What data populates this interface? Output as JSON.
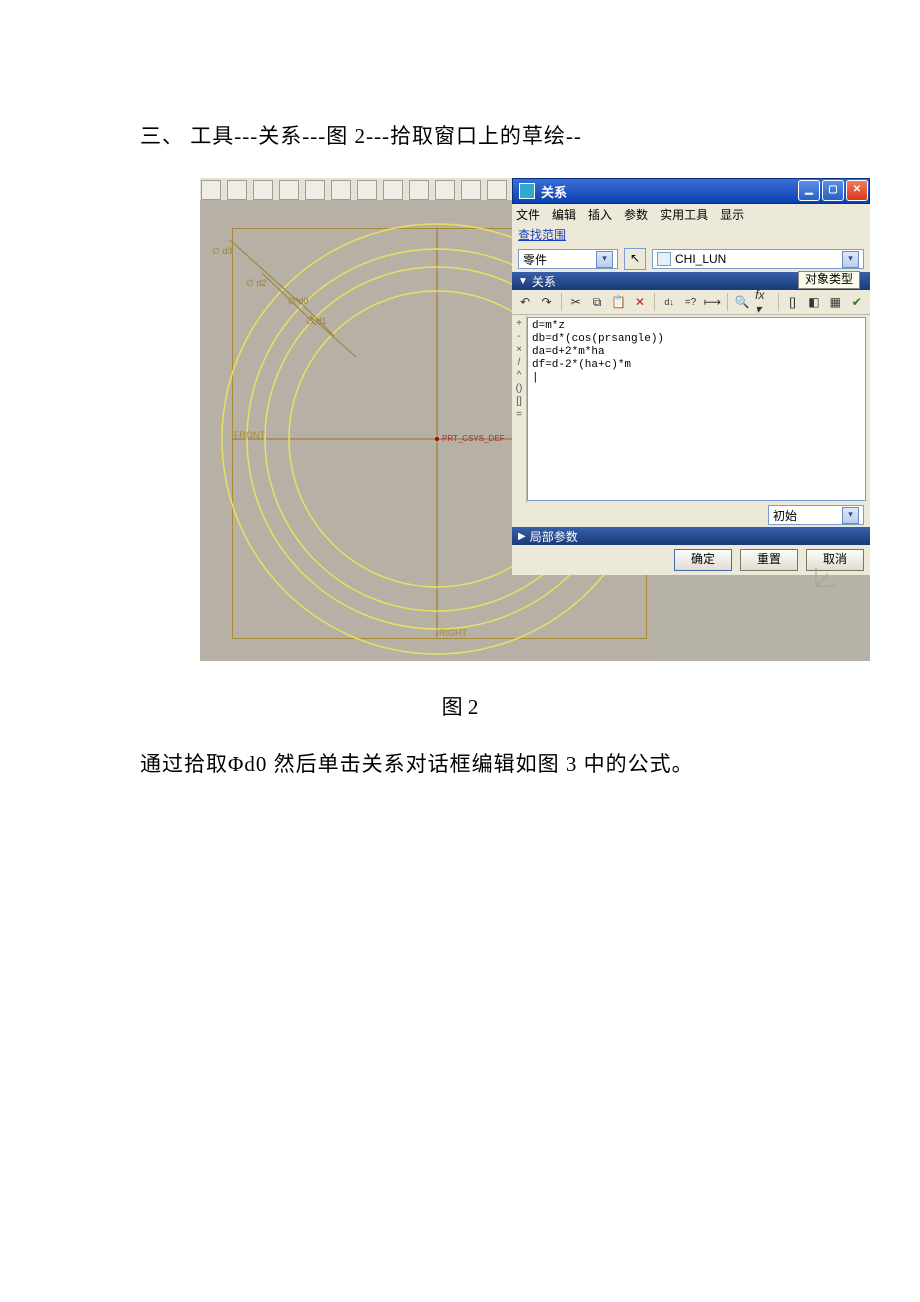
{
  "doc": {
    "heading": "三、 工具---关系---图 2---拾取窗口上的草绘--",
    "caption": "图 2",
    "body_text": "通过拾取Φd0  然后单击关系对话框编辑如图 3 中的公式。"
  },
  "sketch": {
    "axis_front": "FRONT",
    "axis_right": "RIGHT",
    "csys_label": "PRT_CSYS_DEF",
    "dims": {
      "d3": "∅ d3",
      "d2": "∅ d2",
      "d0": "∅ d0",
      "d1": "∅ d1"
    }
  },
  "dialog": {
    "title": "关系",
    "menus": {
      "file": "文件",
      "edit": "编辑",
      "insert": "插入",
      "params": "参数",
      "utilities": "实用工具",
      "show": "显示"
    },
    "lookin_label": "查找范围",
    "type_selected": "零件",
    "model_name": "CHI_LUN",
    "object_type_btn": "对象类型",
    "section_relations": "关系",
    "code_lines": [
      "d=m*z",
      "db=d*(cos(prsangle))",
      "da=d+2*m*ha",
      "df=d-2*(ha+c)*m"
    ],
    "gutter_symbols": [
      "+",
      "-",
      "×",
      "/",
      "^",
      "()",
      "[]",
      "="
    ],
    "init_label": "初始",
    "local_params_label": "局部参数",
    "ok_label": "确定",
    "reset_label": "重置",
    "cancel_label": "取消"
  }
}
